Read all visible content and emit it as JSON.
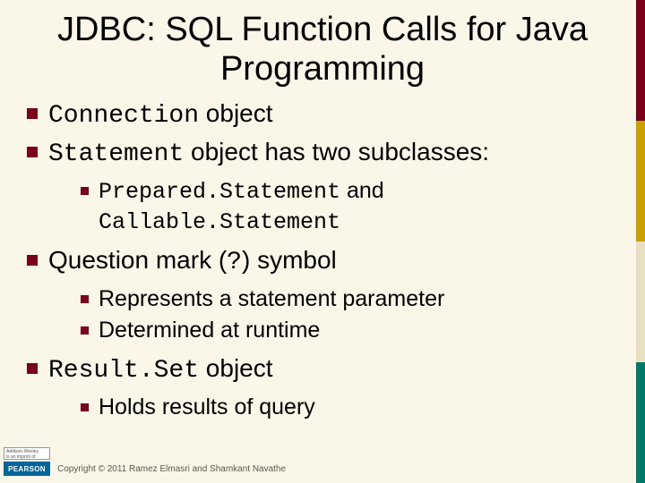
{
  "title": "JDBC: SQL Function Calls for Java Programming",
  "bullets": {
    "b1_code": "Connection",
    "b1_rest": " object",
    "b2_code": "Statement",
    "b2_rest": " object has two subclasses:",
    "b2_sub1_a": "Prepared.Statement",
    "b2_sub1_mid": " and ",
    "b2_sub1_b": "Callable.Statement",
    "b3_a": "Question mark (",
    "b3_code": "?",
    "b3_b": ") symbol",
    "b3_sub1": "Represents a statement parameter",
    "b3_sub2": "Determined at runtime",
    "b4_code": "Result.Set",
    "b4_rest": " object",
    "b4_sub1": "Holds results of query"
  },
  "footer": {
    "imprint_line1": "Addison-Wesley",
    "imprint_line2": "is an imprint of",
    "pearson": "PEARSON",
    "copyright": "Copyright © 2011 Ramez Elmasri and Shamkant Navathe"
  }
}
